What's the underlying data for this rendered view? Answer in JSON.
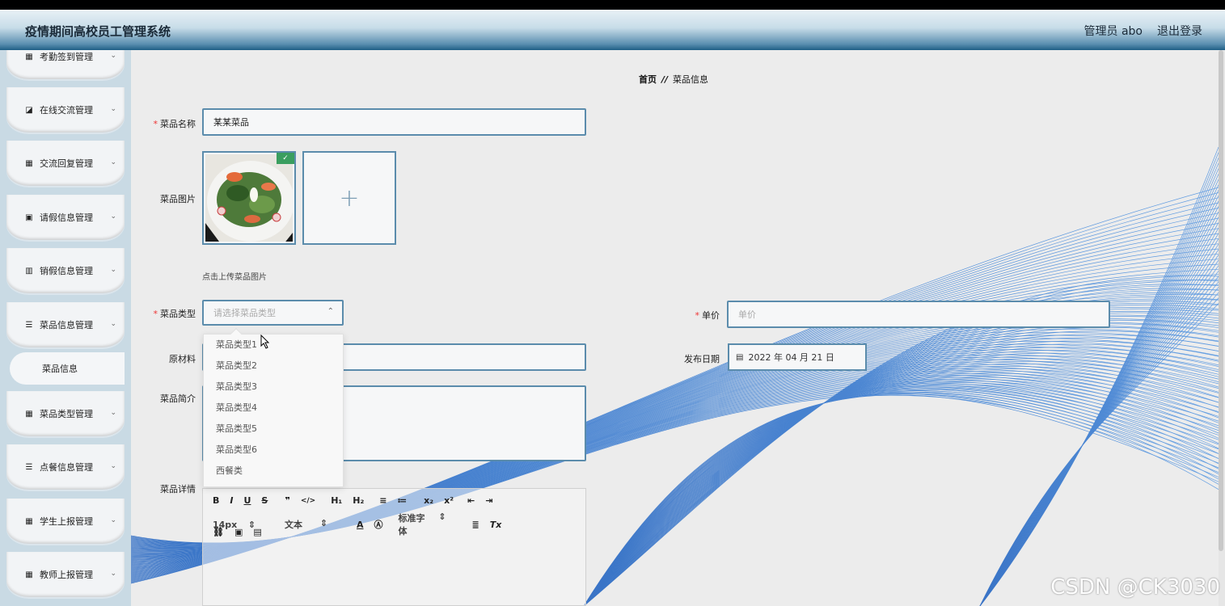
{
  "header": {
    "title": "疫情期间高校员工管理系统",
    "user": "管理员 abo",
    "logout": "退出登录"
  },
  "sidebar": {
    "items": [
      {
        "label": "考勤签到管理",
        "icon": "grid-icon"
      },
      {
        "label": "在线交流管理",
        "icon": "chart-icon"
      },
      {
        "label": "交流回复管理",
        "icon": "grid-icon"
      },
      {
        "label": "请假信息管理",
        "icon": "clipboard-icon"
      },
      {
        "label": "销假信息管理",
        "icon": "bar-chart-icon"
      },
      {
        "label": "菜品信息管理",
        "icon": "list-icon"
      },
      {
        "label": "菜品类型管理",
        "icon": "grid-icon"
      },
      {
        "label": "点餐信息管理",
        "icon": "list-icon"
      },
      {
        "label": "学生上报管理",
        "icon": "grid-icon"
      },
      {
        "label": "教师上报管理",
        "icon": "grid-icon"
      }
    ],
    "sub_item": "菜品信息"
  },
  "breadcrumb": {
    "home": "首页",
    "sep": "//",
    "current": "菜品信息"
  },
  "form": {
    "name_label": "菜品名称",
    "name_value": "某某菜品",
    "image_label": "菜品图片",
    "upload_hint": "点击上传菜品图片",
    "type_label": "菜品类型",
    "type_placeholder": "请选择菜品类型",
    "price_label": "单价",
    "price_placeholder": "单价",
    "material_label": "原材料",
    "date_label": "发布日期",
    "date_value": "2022 年 04 月 21 日",
    "intro_label": "菜品简介",
    "detail_label": "菜品详情"
  },
  "dropdown": {
    "options": [
      "菜品类型1",
      "菜品类型2",
      "菜品类型3",
      "菜品类型4",
      "菜品类型5",
      "菜品类型6",
      "西餐类"
    ]
  },
  "editor": {
    "font_size": "14px",
    "text_style": "文本",
    "font_family": "标准字体"
  },
  "watermark": "CSDN @CK3030"
}
